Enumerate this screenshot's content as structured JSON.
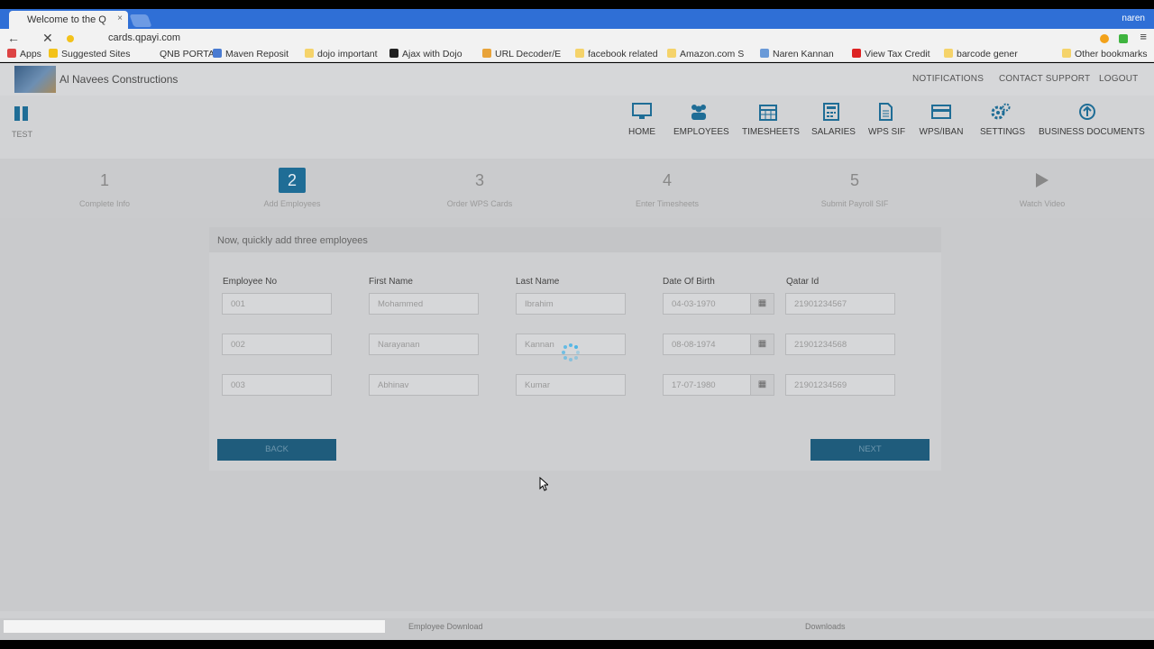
{
  "browser": {
    "tab_title": "Welcome to the Q",
    "tab_close": "×",
    "profile_name": "naren",
    "url": "cards.qpayi.com",
    "back_glyph": "←",
    "stop_glyph": "✕",
    "menu_glyph": "≡",
    "bookmarks": [
      {
        "label": "Apps",
        "icon": "apps-icon",
        "color": "#d44"
      },
      {
        "label": "Suggested Sites",
        "icon": "suggested-sites-icon",
        "color": "#f3c21a"
      },
      {
        "label": "QNB PORTAL",
        "icon": "page-icon",
        "color": "#f2f2f2"
      },
      {
        "label": "Maven Reposit",
        "icon": "maven-icon",
        "color": "#4a7bd1"
      },
      {
        "label": "dojo important",
        "icon": "folder-icon",
        "color": "#f5d36a"
      },
      {
        "label": "Ajax with Dojo",
        "icon": "dojo-icon",
        "color": "#222"
      },
      {
        "label": "URL Decoder/E",
        "icon": "url-decoder-icon",
        "color": "#e8a33a"
      },
      {
        "label": "facebook related",
        "icon": "folder-icon",
        "color": "#f5d36a"
      },
      {
        "label": "Amazon.com S",
        "icon": "amazon-icon",
        "color": "#f5d36a"
      },
      {
        "label": "Naren Kannan",
        "icon": "person-icon",
        "color": "#6a9ad8"
      },
      {
        "label": "View Tax Credit",
        "icon": "tax-icon",
        "color": "#d22"
      },
      {
        "label": "barcode gener",
        "icon": "folder-icon",
        "color": "#f5d36a"
      },
      {
        "label": "Other bookmarks",
        "icon": "folder-icon",
        "color": "#f5d36a"
      }
    ]
  },
  "header": {
    "company": "Al Navees Constructions",
    "links": [
      "NOTIFICATIONS",
      "CONTACT SUPPORT",
      "LOGOUT"
    ]
  },
  "side": {
    "test_label": "TEST"
  },
  "nav": [
    {
      "label": "HOME",
      "icon": "monitor-icon"
    },
    {
      "label": "EMPLOYEES",
      "icon": "users-icon"
    },
    {
      "label": "TIMESHEETS",
      "icon": "calendar-icon"
    },
    {
      "label": "SALARIES",
      "icon": "calculator-icon"
    },
    {
      "label": "WPS SIF",
      "icon": "document-icon"
    },
    {
      "label": "WPS/IBAN",
      "icon": "card-icon"
    },
    {
      "label": "SETTINGS",
      "icon": "gears-icon"
    },
    {
      "label": "BUSINESS DOCUMENTS",
      "icon": "upload-icon"
    }
  ],
  "steps": [
    {
      "num": "1",
      "label": "Complete Info"
    },
    {
      "num": "2",
      "label": "Add Employees"
    },
    {
      "num": "3",
      "label": "Order WPS Cards"
    },
    {
      "num": "4",
      "label": "Enter Timesheets"
    },
    {
      "num": "5",
      "label": "Submit Payroll SIF"
    },
    {
      "num": "",
      "label": "Watch Video"
    }
  ],
  "form": {
    "heading": "Now, quickly add three employees",
    "columns": [
      "Employee No",
      "First Name",
      "Last Name",
      "Date Of Birth",
      "Qatar Id"
    ],
    "rows": [
      [
        "001",
        "Mohammed",
        "Ibrahim",
        "04-03-1970",
        "21901234567"
      ],
      [
        "002",
        "Narayanan",
        "Kannan",
        "08-08-1974",
        "21901234568"
      ],
      [
        "003",
        "Abhinav",
        "Kumar",
        "17-07-1980",
        "21901234569"
      ]
    ],
    "calendar_glyph": "▦",
    "back_label": "BACK",
    "next_label": "NEXT"
  },
  "footer": {
    "links": [
      "Employee Download",
      "Downloads"
    ]
  },
  "colors": {
    "accent": "#1f6d96",
    "spinner": "#49b4e6",
    "chrome_blue": "#2f6fd6"
  }
}
